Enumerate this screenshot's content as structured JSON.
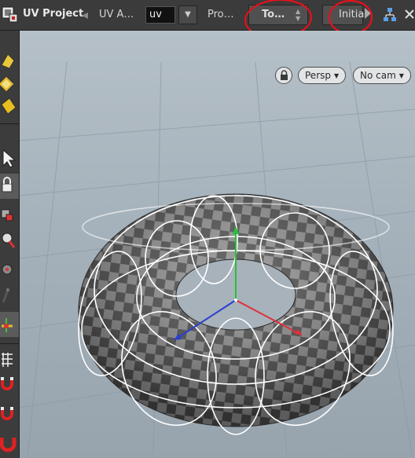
{
  "toolbar": {
    "title": "UV Project",
    "uv_attr_label": "UV A…",
    "uv_attr_value": "uv",
    "projection_label": "Pro…",
    "torus_button": "To…",
    "initialize_button": "Initia"
  },
  "viewport": {
    "perspective_menu": "Persp",
    "camera_menu": "No cam",
    "axis_colors": {
      "x": "#e0303a",
      "y": "#22c23a",
      "z": "#2a3fd0"
    },
    "annotation_color": "#e8101a"
  },
  "left_tools": [
    "handle-tool-icon",
    "snap-tool-icon",
    "gem-tool-icon",
    "select-arrow-icon",
    "lock-icon",
    "cube-tool-icon",
    "magnify-icon",
    "render-icon",
    "bone-icon",
    "uv-transform-icon",
    "grid-snap-icon",
    "magnet-icon",
    "magnet-alt-icon",
    "magnet-big-icon"
  ]
}
